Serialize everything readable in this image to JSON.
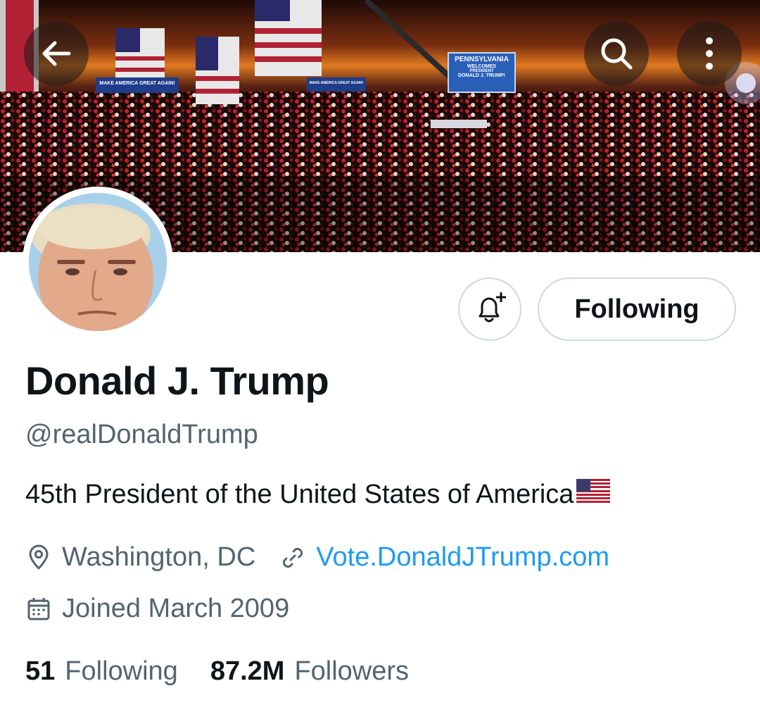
{
  "nav": {
    "back_icon": "arrow-left-icon",
    "search_icon": "search-icon",
    "more_icon": "more-vertical-icon"
  },
  "banner": {
    "sign_text_1": "MAKE AMERICA GREAT AGAIN!",
    "sign_text_2": "MAKE AMERICA GREAT AGAIN!",
    "big_sign_line1": "PENNSYLVANIA",
    "big_sign_line2": "WELCOMES",
    "big_sign_line3": "PRESIDENT",
    "big_sign_line4": "DONALD J. TRUMP!"
  },
  "actions": {
    "notify_icon": "bell-plus-icon",
    "following_label": "Following"
  },
  "profile": {
    "name": "Donald J. Trump",
    "handle": "@realDonaldTrump",
    "bio": "45th President of the United States of America",
    "location": "Washington, DC",
    "website": "Vote.DonaldJTrump.com",
    "joined": "Joined March 2009"
  },
  "stats": {
    "following_count": "51",
    "following_label": "Following",
    "followers_count": "87.2M",
    "followers_label": "Followers"
  },
  "colors": {
    "link": "#1d9bf0",
    "secondary_text": "#536471",
    "primary_text": "#0f1419",
    "border": "#cfd9de"
  }
}
